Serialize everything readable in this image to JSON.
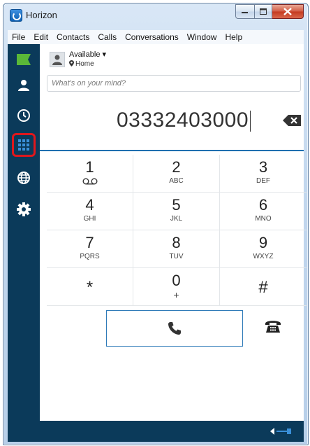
{
  "window": {
    "title": "Horizon"
  },
  "menu": [
    "File",
    "Edit",
    "Contacts",
    "Calls",
    "Conversations",
    "Window",
    "Help"
  ],
  "sidebar": {
    "items": [
      {
        "name": "flag-icon"
      },
      {
        "name": "user-icon"
      },
      {
        "name": "clock-icon"
      },
      {
        "name": "dialpad-icon",
        "selected": true
      },
      {
        "name": "globe-icon"
      },
      {
        "name": "gear-icon"
      }
    ]
  },
  "status": {
    "availability": "Available ▾",
    "location": "Home"
  },
  "post": {
    "placeholder": "What's on your mind?"
  },
  "dialer": {
    "number": "03332403000"
  },
  "keys": [
    {
      "digit": "1",
      "letters": ""
    },
    {
      "digit": "2",
      "letters": "ABC"
    },
    {
      "digit": "3",
      "letters": "DEF"
    },
    {
      "digit": "4",
      "letters": "GHI"
    },
    {
      "digit": "5",
      "letters": "JKL"
    },
    {
      "digit": "6",
      "letters": "MNO"
    },
    {
      "digit": "7",
      "letters": "PQRS"
    },
    {
      "digit": "8",
      "letters": "TUV"
    },
    {
      "digit": "9",
      "letters": "WXYZ"
    },
    {
      "digit": "*",
      "letters": ""
    },
    {
      "digit": "0",
      "letters": "+"
    },
    {
      "digit": "#",
      "letters": ""
    }
  ],
  "colors": {
    "sidebar": "#0b3a5a",
    "accent": "#1f6fb0",
    "highlight": "#e0171c",
    "flag": "#5ab838"
  }
}
